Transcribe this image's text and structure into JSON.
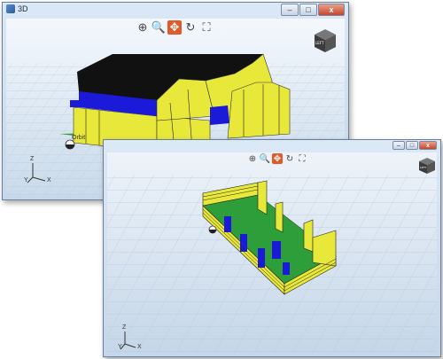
{
  "back_window": {
    "title": "3D",
    "controls": {
      "minimize": "–",
      "maximize": "□",
      "close": "x"
    },
    "toolbar": [
      {
        "name": "zoom-window-icon",
        "glyph": "⊕",
        "active": false
      },
      {
        "name": "zoom-icon",
        "glyph": "🔍",
        "active": false
      },
      {
        "name": "pan-icon",
        "glyph": "✥",
        "active": true
      },
      {
        "name": "rotate-icon",
        "glyph": "↻",
        "active": false
      },
      {
        "name": "fit-view-icon",
        "glyph": "⛶",
        "active": false
      }
    ],
    "navcube_label": "LEFT",
    "orbit_label": "Orbit",
    "axes": {
      "z": "Z",
      "y": "Y",
      "x": "X"
    }
  },
  "front_window": {
    "title": "",
    "controls": {
      "minimize": "–",
      "maximize": "□",
      "close": "x"
    },
    "toolbar": [
      {
        "name": "zoom-window-icon",
        "glyph": "⊕",
        "active": false
      },
      {
        "name": "zoom-icon",
        "glyph": "🔍",
        "active": false
      },
      {
        "name": "pan-icon",
        "glyph": "✥",
        "active": true
      },
      {
        "name": "rotate-icon",
        "glyph": "↻",
        "active": false
      },
      {
        "name": "fit-view-icon",
        "glyph": "⛶",
        "active": false
      }
    ],
    "navcube_label": "LEFT",
    "axes": {
      "z": "Z",
      "y": "Y",
      "x": "X"
    }
  },
  "colors": {
    "wall_yellow": "#e8e83a",
    "roof_black": "#111111",
    "blue": "#1a1ad8",
    "floor_green": "#2e9e3a",
    "active_tool": "#e05a2a"
  }
}
